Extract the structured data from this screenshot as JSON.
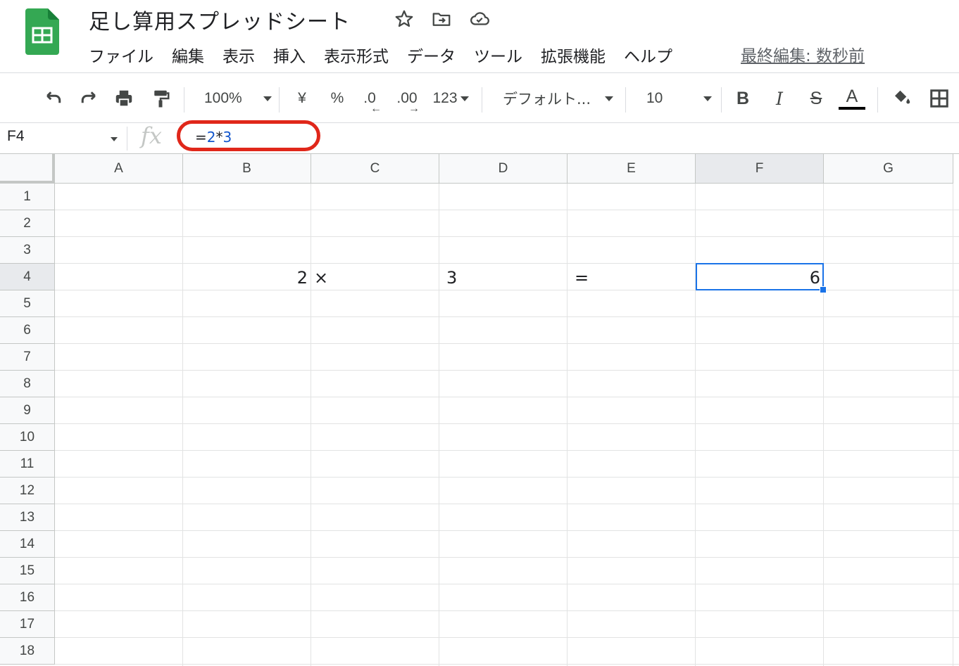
{
  "app": {
    "title": "足し算用スプレッドシート",
    "last_edit": "最終編集: 数秒前",
    "logo_icon": "google-sheets-logo-icon",
    "accent": "#1a73e8",
    "highlight": "#e0271a"
  },
  "menu": [
    "ファイル",
    "編集",
    "表示",
    "挿入",
    "表示形式",
    "データ",
    "ツール",
    "拡張機能",
    "ヘルプ"
  ],
  "toolbar": {
    "zoom": "100%",
    "currency": "¥",
    "percent": "%",
    "decimal_decrease": ".0",
    "decimal_increase": ".00",
    "more_formats": "123",
    "font": "デフォルト...",
    "font_size": "10",
    "bold": "B",
    "italic": "I",
    "strike": "S",
    "text_color": "A"
  },
  "formula_bar": {
    "name_box": "F4",
    "fx": "fx",
    "formula_eq": "=",
    "formula_ref1": "2",
    "formula_op": "*",
    "formula_ref2": "3"
  },
  "sheet": {
    "columns": [
      "A",
      "B",
      "C",
      "D",
      "E",
      "F",
      "G"
    ],
    "rows": [
      "1",
      "2",
      "3",
      "4",
      "5",
      "6",
      "7",
      "8",
      "9",
      "10",
      "11",
      "12",
      "13",
      "14",
      "15",
      "16",
      "17",
      "18"
    ],
    "selected_cell": "F4",
    "cells": {
      "B4": "2",
      "C4": "×",
      "D4": "3",
      "E4": "=",
      "F4": "6"
    }
  }
}
